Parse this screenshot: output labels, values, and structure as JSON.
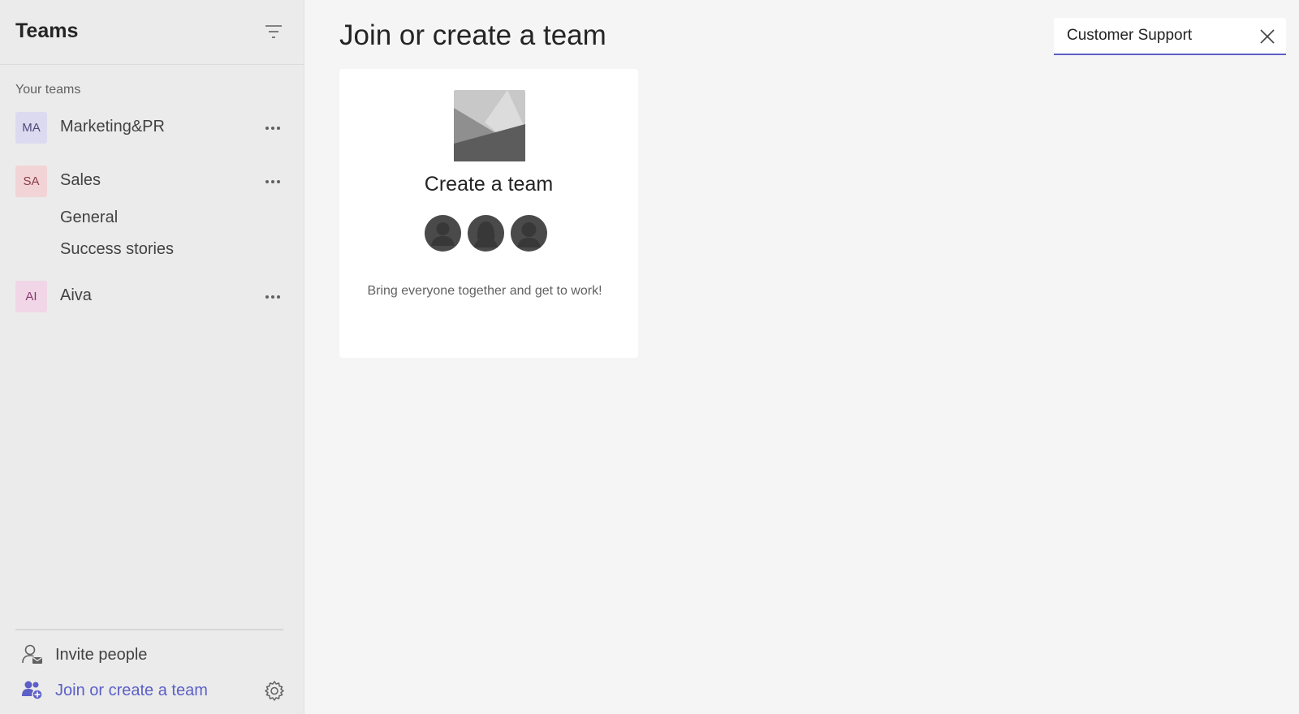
{
  "sidebar": {
    "title": "Teams",
    "section_label": "Your teams",
    "teams": [
      {
        "initials": "MA",
        "name": "Marketing&PR",
        "avatar_bg": "#dcdaf0",
        "avatar_fg": "#4b4a7a"
      },
      {
        "initials": "SA",
        "name": "Sales",
        "avatar_bg": "#f2d4d7",
        "avatar_fg": "#8a3a44",
        "channels": [
          "General",
          "Success stories"
        ]
      },
      {
        "initials": "AI",
        "name": "Aiva",
        "avatar_bg": "#f0d6e6",
        "avatar_fg": "#8a3a6e"
      }
    ],
    "actions": {
      "invite_label": "Invite people",
      "join_label": "Join or create a team"
    }
  },
  "main": {
    "title": "Join or create a team",
    "search": {
      "value": "Customer Support"
    },
    "create_card": {
      "title": "Create a team",
      "description": "Bring everyone together and get to work!"
    }
  },
  "colors": {
    "accent": "#5b5fc7",
    "sidebar_bg": "#ebebeb",
    "main_bg": "#f5f5f5",
    "card_bg": "#ffffff"
  },
  "icons": {
    "filter": "filter-icon",
    "more": "more-options-icon",
    "invite": "person-mail-icon",
    "join": "people-add-icon",
    "settings": "gear-icon",
    "clear": "close-icon"
  }
}
